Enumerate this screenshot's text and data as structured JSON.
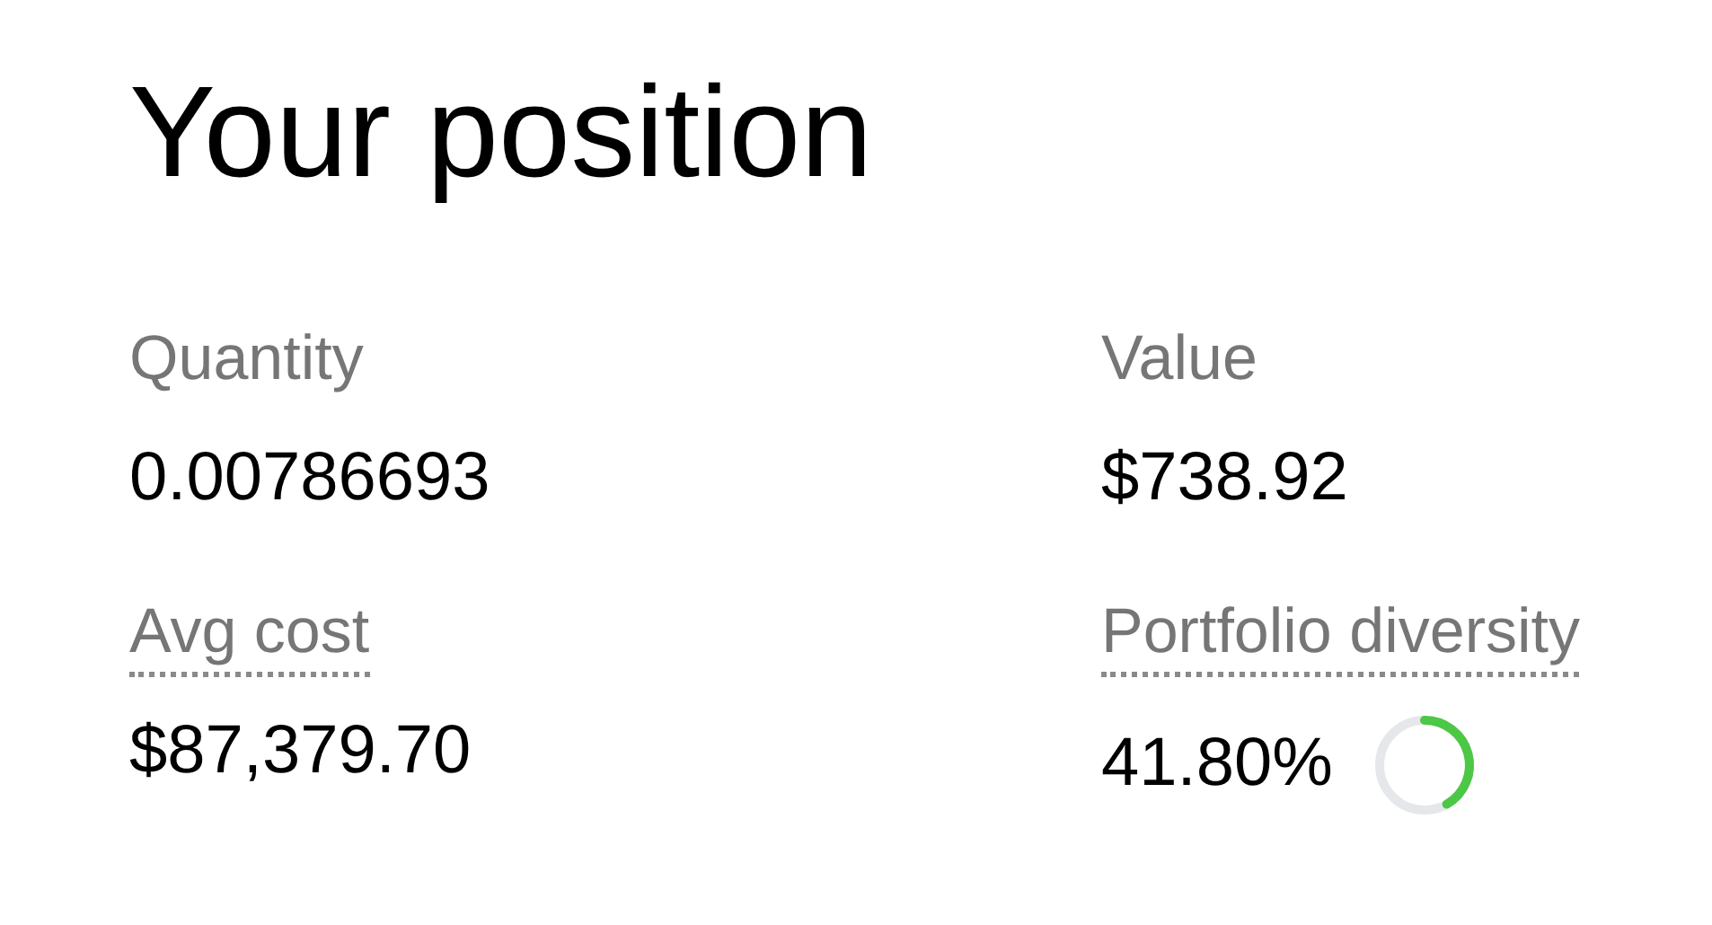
{
  "title": "Your position",
  "stats": [
    {
      "label": "Quantity",
      "value": "0.00786693",
      "dotted_underline": false
    },
    {
      "label": "Value",
      "value": "$738.92",
      "dotted_underline": false
    },
    {
      "label": "Avg cost",
      "value": "$87,379.70",
      "dotted_underline": true
    },
    {
      "label": "Portfolio diversity",
      "value": "41.80%",
      "dotted_underline": true,
      "ring": {
        "level": 0.418
      }
    }
  ]
}
